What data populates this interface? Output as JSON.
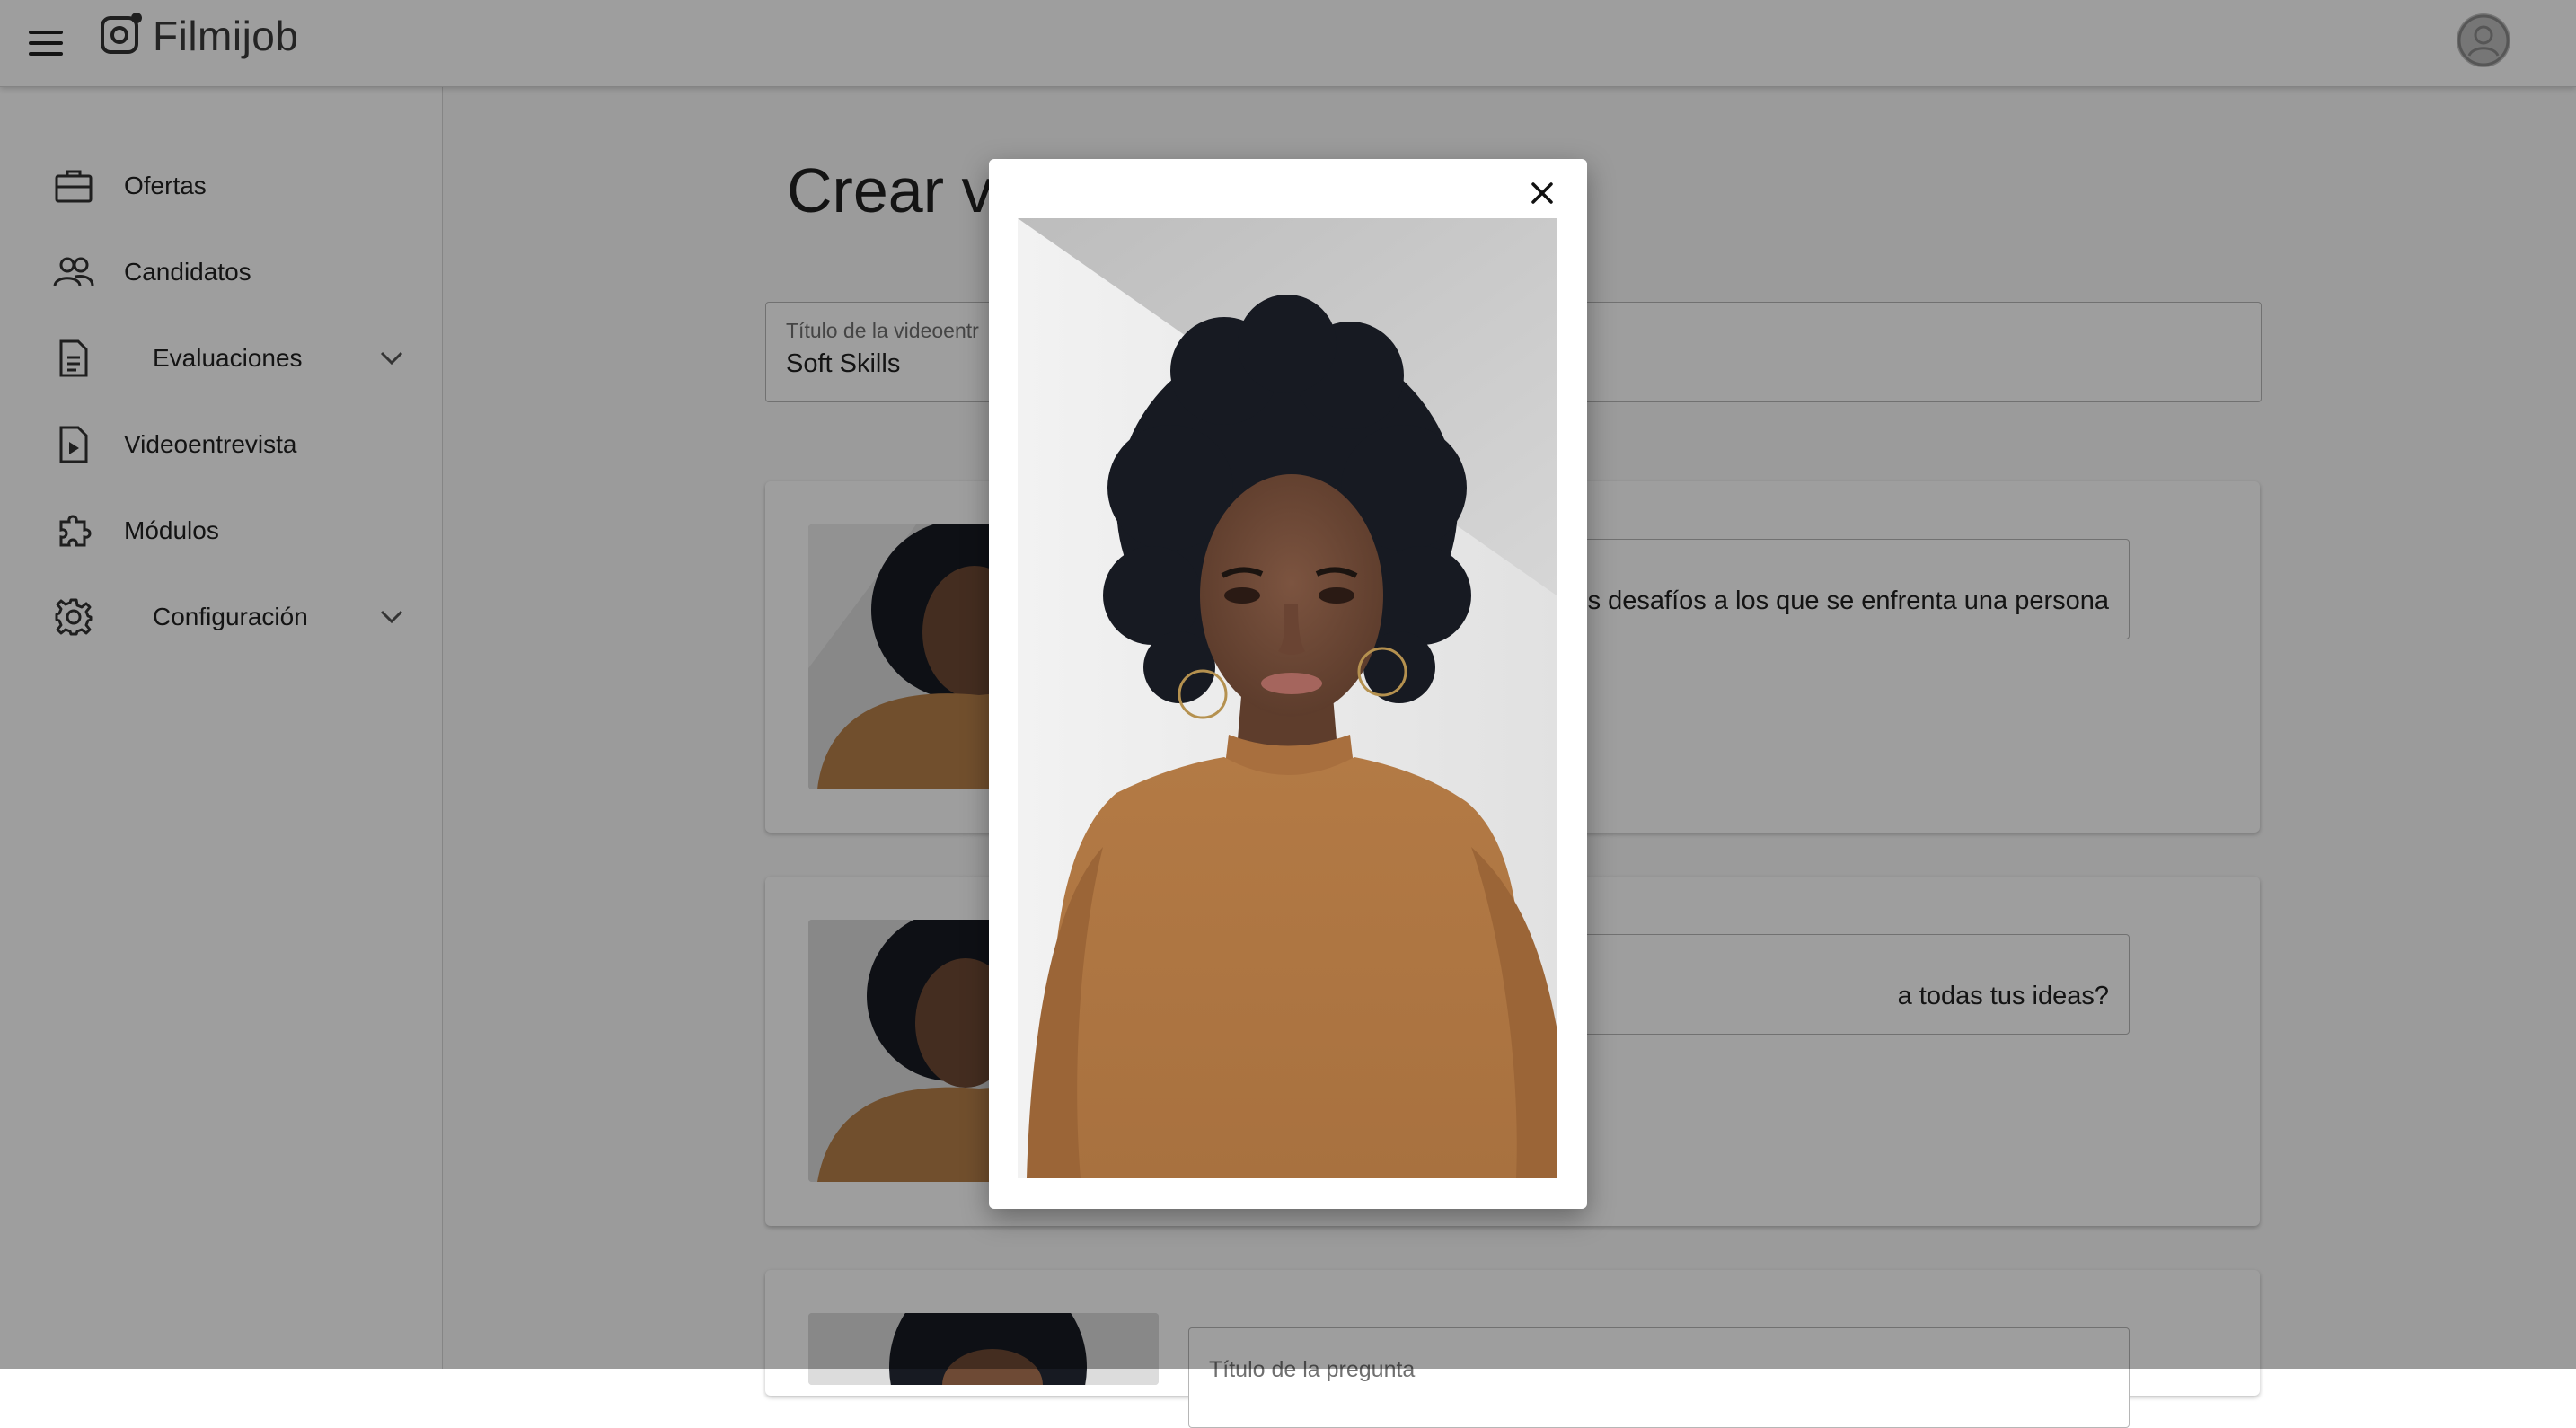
{
  "app": {
    "name": "Filmijob",
    "menu_icon": "hamburger-menu-icon",
    "logo_icon": "camera-lens-icon",
    "avatar_icon": "user-avatar-icon"
  },
  "sidebar": {
    "items": [
      {
        "label": "Ofertas",
        "icon": "briefcase-icon"
      },
      {
        "label": "Candidatos",
        "icon": "people-icon"
      },
      {
        "label": "Evaluaciones",
        "icon": "document-icon",
        "chevron": "chevron-down-icon"
      },
      {
        "label": "Videoentrevista",
        "icon": "video-file-icon"
      },
      {
        "label": "Módulos",
        "icon": "puzzle-icon"
      },
      {
        "label": "Configuración",
        "icon": "gear-icon",
        "chevron": "chevron-down-icon"
      }
    ]
  },
  "main": {
    "page_title": "Crear vi",
    "title_field": {
      "label": "Título de la videoentr",
      "value": "Soft Skills"
    },
    "questions": [
      {
        "text": "es desafíos a los que se enfrenta una persona"
      },
      {
        "text": "a todas tus ideas?"
      },
      {
        "label": "Título de la pregunta"
      }
    ]
  },
  "modal": {
    "close_icon": "close-icon",
    "video_subject": "woman-curly-hair-mustard-turtleneck"
  },
  "colors": {
    "overlay": "rgba(0,0,0,0.38)",
    "sweater": "#b7804a",
    "hair": "#171a22",
    "wall": "#e6e6e6"
  }
}
